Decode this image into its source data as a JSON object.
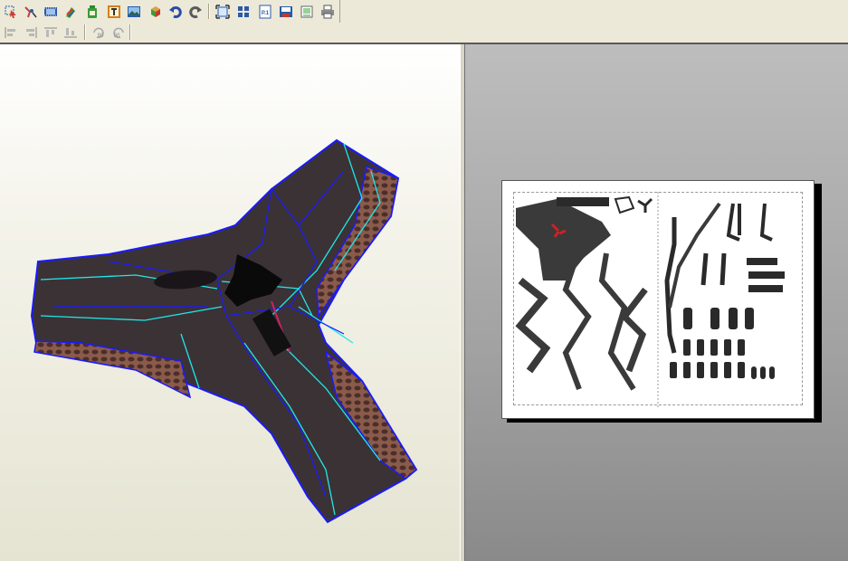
{
  "toolbar_top": {
    "buttons": [
      {
        "icon": "select-arrow-icon",
        "color": "#d83a2a"
      },
      {
        "icon": "edge-join-icon",
        "color": "#c04040"
      },
      {
        "icon": "film-strip-icon",
        "color": "#2a5aa8"
      },
      {
        "icon": "paint-icon",
        "color": "#3a9a3a"
      },
      {
        "icon": "bottle-icon",
        "color": "#3a9a3a"
      },
      {
        "icon": "text-tool-icon",
        "color": "#d8801a"
      },
      {
        "icon": "image-icon",
        "color": "#2a5aa8"
      },
      {
        "icon": "box-3d-icon",
        "color": "#c03a2a"
      },
      {
        "icon": "undo-icon",
        "color": "#2a4aa8"
      },
      {
        "icon": "redo-icon",
        "color": "#5a5a5a"
      },
      {
        "icon": "fit-view-icon",
        "color": "#2a5aa8"
      },
      {
        "icon": "arrange-parts-icon",
        "color": "#2a5aa8"
      },
      {
        "icon": "page-one-icon",
        "color": "#2a5aa8",
        "label": "P.1"
      },
      {
        "icon": "save-pages-icon",
        "color": "#c03a2a"
      },
      {
        "icon": "page-setup-icon",
        "color": "#3a9a3a"
      },
      {
        "icon": "print-icon",
        "color": "#5a5a5a"
      }
    ]
  },
  "toolbar_bottom": {
    "buttons": [
      {
        "icon": "align-left-icon"
      },
      {
        "icon": "align-right-icon"
      },
      {
        "icon": "align-top-icon"
      },
      {
        "icon": "align-bottom-icon"
      },
      {
        "icon": "rotate-ccw-90-icon",
        "label": "90"
      },
      {
        "icon": "rotate-cw-90-icon",
        "label": "90"
      }
    ]
  },
  "view_3d": {
    "model_edge_color": "#1a1aff",
    "fold_line_color": "#20e8e8",
    "highlight_color": "#cc2266",
    "texture_dark": "#3b3236",
    "texture_rust": "#8a5a4a"
  },
  "view_2d": {
    "paper_color": "#ffffff",
    "print_area_border": "#999999",
    "part_color": "#3a3a3a",
    "marker_color": "#cc2222"
  }
}
